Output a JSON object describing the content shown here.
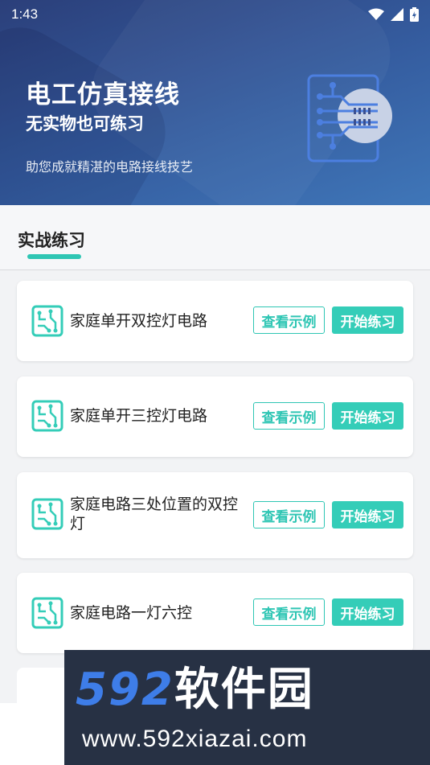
{
  "status_bar": {
    "time": "1:43"
  },
  "hero": {
    "title": "电工仿真接线",
    "subtitle": "无实物也可练习",
    "description": "助您成就精湛的电路接线技艺"
  },
  "section": {
    "title": "实战练习"
  },
  "exercises": [
    {
      "title": "家庭单开双控灯电路",
      "example_label": "查看示例",
      "start_label": "开始练习"
    },
    {
      "title": "家庭单开三控灯电路",
      "example_label": "查看示例",
      "start_label": "开始练习"
    },
    {
      "title": "家庭电路三处位置的双控灯",
      "example_label": "查看示例",
      "start_label": "开始练习"
    },
    {
      "title": "家庭电路一灯六控",
      "example_label": "查看示例",
      "start_label": "开始练习"
    }
  ],
  "watermark": {
    "brand_num": "592",
    "brand_cn": "软件园",
    "url": "www.592xiazai.com"
  },
  "colors": {
    "accent": "#34cdb8",
    "header_top": "#2b3f7a",
    "header_bottom": "#3f76b8"
  }
}
